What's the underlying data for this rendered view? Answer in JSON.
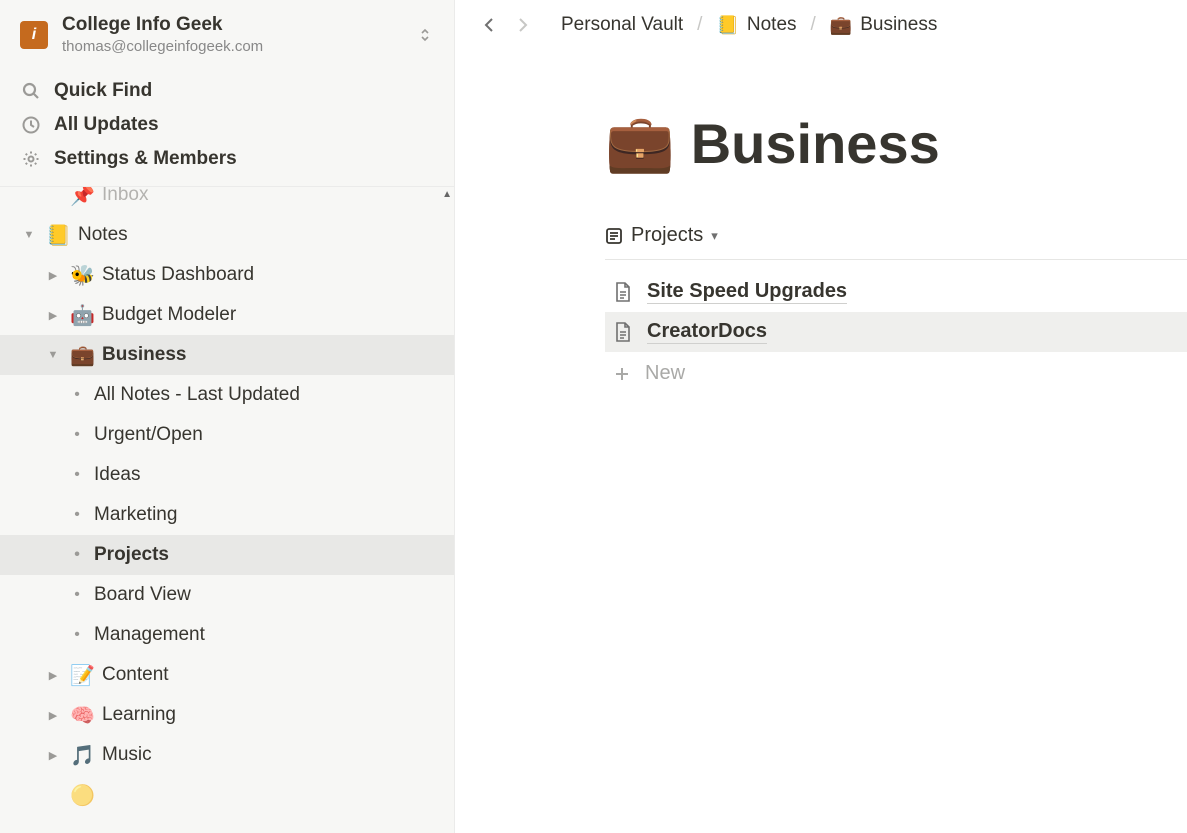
{
  "workspace": {
    "name": "College Info Geek",
    "email": "thomas@collegeinfogeek.com",
    "logo_letter": "i"
  },
  "sidebar_nav": {
    "quick_find": "Quick Find",
    "all_updates": "All Updates",
    "settings": "Settings & Members"
  },
  "tree": {
    "inbox_partial": "Inbox",
    "notes": "Notes",
    "status_dashboard": "Status Dashboard",
    "budget_modeler": "Budget Modeler",
    "business": "Business",
    "all_notes": "All Notes - Last Updated",
    "urgent_open": "Urgent/Open",
    "ideas": "Ideas",
    "marketing": "Marketing",
    "projects": "Projects",
    "board_view": "Board View",
    "management": "Management",
    "content": "Content",
    "learning": "Learning",
    "music": "Music"
  },
  "breadcrumb": {
    "root": "Personal Vault",
    "notes": "Notes",
    "business": "Business"
  },
  "page": {
    "title": "Business"
  },
  "database": {
    "view_name": "Projects",
    "rows": [
      {
        "title": "Site Speed Upgrades"
      },
      {
        "title": "CreatorDocs"
      }
    ],
    "new_label": "New"
  }
}
